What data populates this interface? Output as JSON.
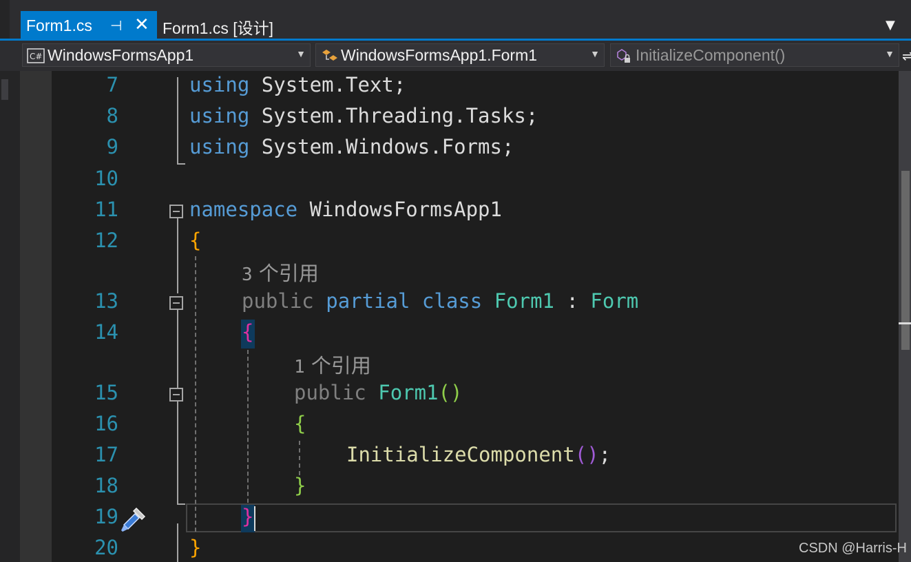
{
  "tabs": [
    {
      "label": "Form1.cs",
      "active": true,
      "pin_icon": "pin-icon",
      "close_icon": "close-icon"
    },
    {
      "label": "Form1.cs [设计]",
      "active": false
    }
  ],
  "nav": {
    "project": "WindowsFormsApp1",
    "type": "WindowsFormsApp1.Form1",
    "member": "InitializeComponent()"
  },
  "colors": {
    "accent": "#007acc",
    "keyword": "#569cd6",
    "type": "#4ec9b0",
    "method": "#dcdcaa",
    "line_number": "#2b91af",
    "background": "#1e1e1e"
  },
  "code": {
    "lines": [
      {
        "num": "7",
        "text": "using System.Text;"
      },
      {
        "num": "8",
        "text": "using System.Threading.Tasks;"
      },
      {
        "num": "9",
        "text": "using System.Windows.Forms;"
      },
      {
        "num": "10",
        "text": ""
      },
      {
        "num": "11",
        "text": "namespace WindowsFormsApp1"
      },
      {
        "num": "12",
        "text": "{"
      },
      {
        "num": "13",
        "text": "public partial class Form1 : Form"
      },
      {
        "num": "14",
        "text": "{"
      },
      {
        "num": "15",
        "text": "public Form1()"
      },
      {
        "num": "16",
        "text": "{"
      },
      {
        "num": "17",
        "text": "InitializeComponent();"
      },
      {
        "num": "18",
        "text": "}"
      },
      {
        "num": "19",
        "text": "}"
      },
      {
        "num": "20",
        "text": "}"
      }
    ],
    "tokens": {
      "using": "using",
      "ns1": "System.Text;",
      "ns2": "System.Threading.Tasks;",
      "ns3": "System.Windows.Forms;",
      "namespace": "namespace",
      "ns_name": "WindowsFormsApp1",
      "public": "public",
      "partial": "partial",
      "class": "class",
      "class_name": "Form1",
      "colon": ":",
      "base": "Form",
      "ctor": "Form1",
      "call": "InitializeComponent",
      "open_brace": "{",
      "close_brace": "}",
      "paren_open": "(",
      "paren_close": ")",
      "semicolon": ";"
    },
    "codelens": [
      {
        "count": "3",
        "text": "个引用"
      },
      {
        "count": "1",
        "text": "个引用"
      }
    ]
  },
  "watermark": "CSDN @Harris-H"
}
